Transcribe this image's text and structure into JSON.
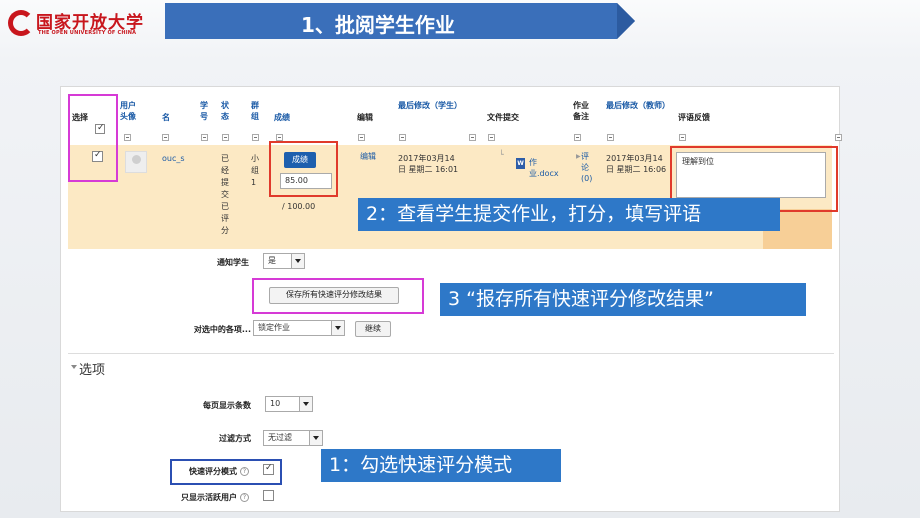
{
  "slide": {
    "logo": {
      "cn": "国家开放大学",
      "en": "THE OPEN UNIVERSITY OF CHINA"
    },
    "title": "1、批阅学生作业",
    "banner_color": "#3a6fba"
  },
  "table": {
    "headers": {
      "select": "选择",
      "avatar": "用户头像",
      "name": "名",
      "id": "学号",
      "status": "状态",
      "group": "群组",
      "grade": "成绩",
      "edit": "编辑",
      "modified_student": "最后修改（学生）",
      "file_submission": "文件提交",
      "assignment_note": "作业备注",
      "modified_teacher": "最后修改（教师）",
      "feedback": "评语反馈"
    },
    "row": {
      "name": "ouc_s",
      "status": "已经提交已评分",
      "group": "小组1",
      "grade_button": "成绩",
      "grade_value": "85.00",
      "grade_max": "/ 100.00",
      "edit_link": "编辑",
      "modified_student": "2017年03月14日 星期二 16:01",
      "file_icon": "word-doc-icon",
      "file_name": "作业.docx",
      "comments": "评论(0)",
      "modified_teacher": "2017年03月14日 星期二 16:06",
      "feedback_text": "理解到位"
    }
  },
  "form": {
    "notify_label": "通知学生",
    "notify_value": "是",
    "save_button": "保存所有快速评分修改结果",
    "bulk_label": "对选中的各项...",
    "bulk_value": "锁定作业",
    "go_button": "继续",
    "options_heading": "选项",
    "per_page_label": "每页显示条数",
    "per_page_value": "10",
    "filter_label": "过滤方式",
    "filter_value": "无过滤",
    "quick_grading_label": "快速评分模式",
    "active_only_label": "只显示活跃用户"
  },
  "callouts": {
    "c1": "1：勾选快速评分模式",
    "c2": "2：查看学生提交作业，打分，填写评语",
    "c3": "3 “报存所有快速评分修改结果”"
  },
  "colors": {
    "callout": "#2e78c8",
    "red": "#e03a2b",
    "magenta": "#d63ad6",
    "blue": "#2b4fb2",
    "row": "#fce9c4"
  }
}
